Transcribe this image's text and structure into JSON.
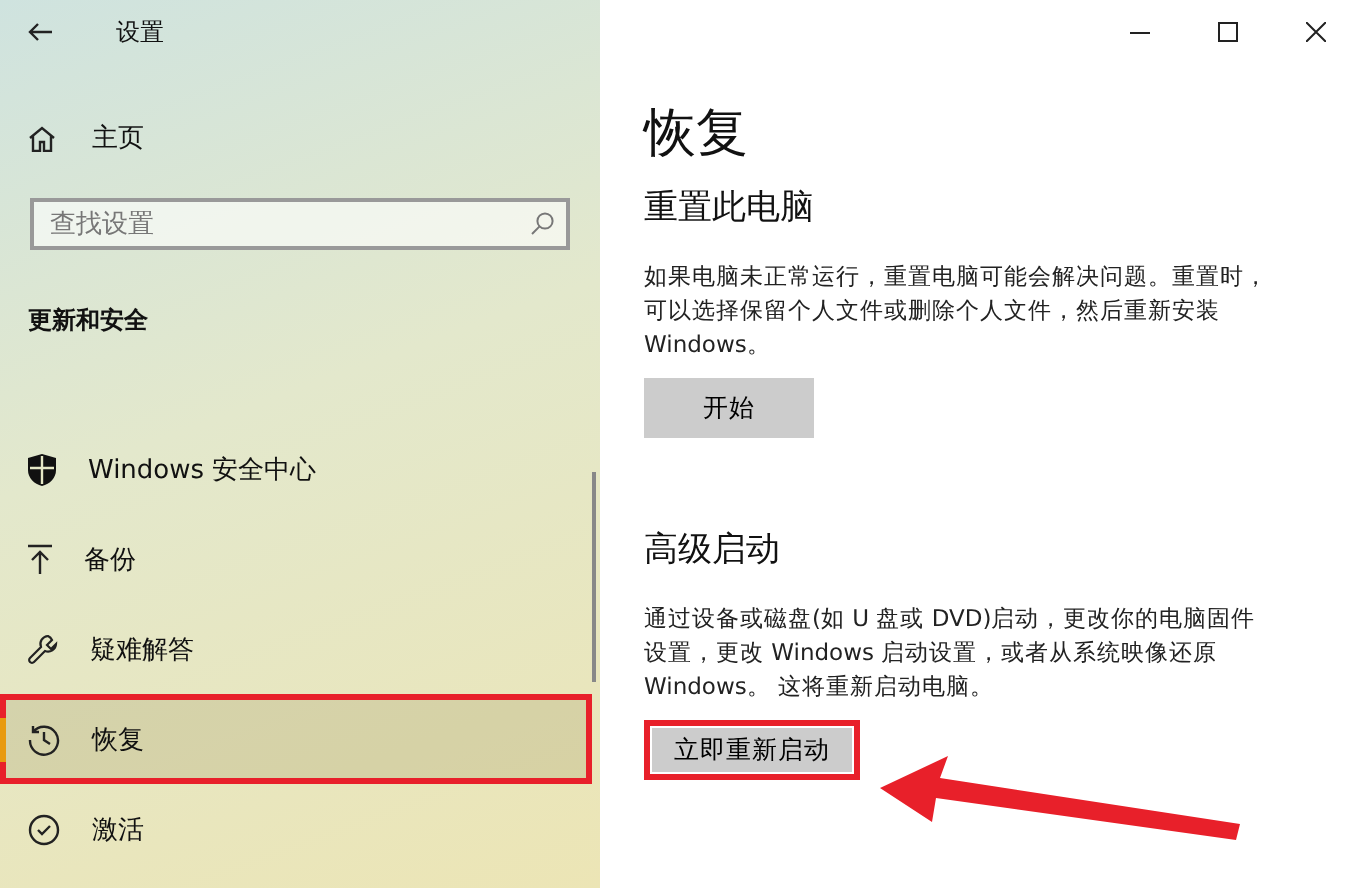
{
  "window": {
    "title": "设置"
  },
  "sidebar": {
    "home": "主页",
    "search": {
      "placeholder": "查找设置"
    },
    "section": "更新和安全",
    "items": [
      {
        "kind": "shield",
        "label": "Windows 安全中心",
        "selected": false,
        "highlighted": false
      },
      {
        "kind": "backup",
        "label": "备份",
        "selected": false,
        "highlighted": false
      },
      {
        "kind": "wrench",
        "label": "疑难解答",
        "selected": false,
        "highlighted": false
      },
      {
        "kind": "history",
        "label": "恢复",
        "selected": true,
        "highlighted": true
      },
      {
        "kind": "check",
        "label": "激活",
        "selected": false,
        "highlighted": false
      }
    ]
  },
  "content": {
    "title": "恢复",
    "sections": [
      {
        "heading": "重置此电脑",
        "text": "如果电脑未正常运行，重置电脑可能会解决问题。重置时，可以选择保留个人文件或删除个人文件，然后重新安装 Windows。",
        "button": "开始",
        "highlighted": false
      },
      {
        "heading": "高级启动",
        "text": "通过设备或磁盘(如 U 盘或 DVD)启动，更改你的电脑固件设置，更改 Windows 启动设置，或者从系统映像还原 Windows。 这将重新启动电脑。",
        "button": "立即重新启动",
        "highlighted": true
      }
    ]
  }
}
